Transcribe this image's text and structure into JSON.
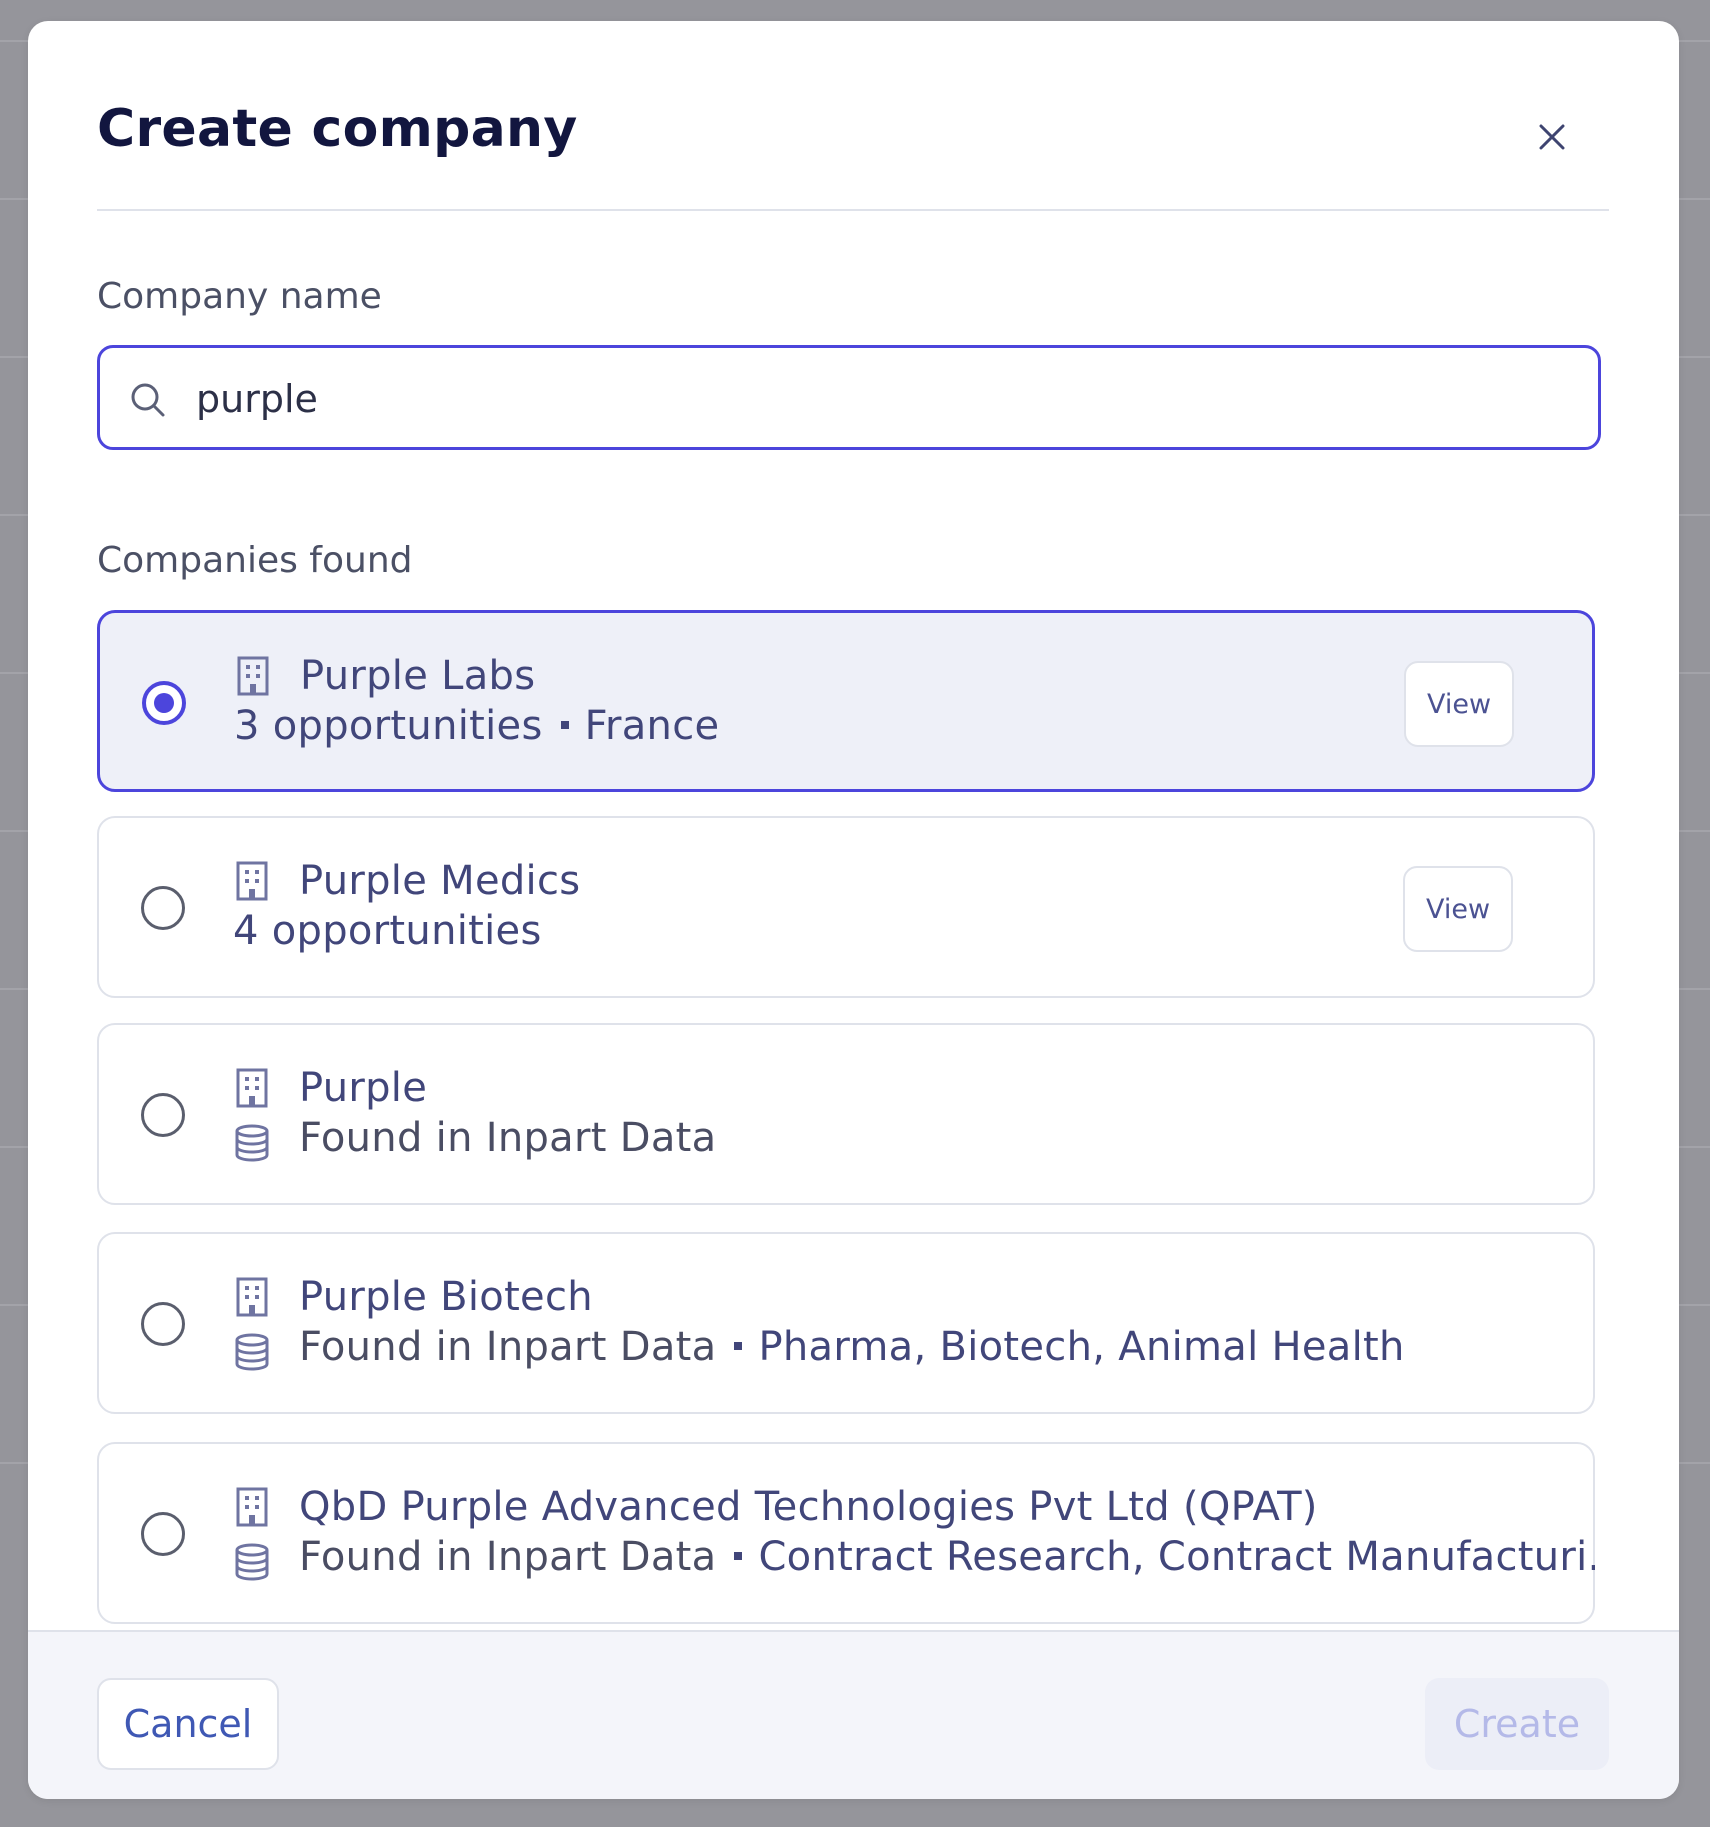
{
  "dialog": {
    "title": "Create company",
    "close_label": "×"
  },
  "form": {
    "company_name_label": "Company name",
    "search_value": "purple",
    "companies_found_label": "Companies found"
  },
  "companies": [
    {
      "name": "Purple Labs",
      "opportunities": "3 opportunities",
      "country": "France",
      "selected": true,
      "view_label": "View",
      "icons": [
        "building-icon"
      ]
    },
    {
      "name": "Purple Medics",
      "opportunities": "4 opportunities",
      "selected": false,
      "view_label": "View",
      "icons": [
        "building-icon"
      ]
    },
    {
      "name": "Purple",
      "source": "Found in Inpart Data",
      "selected": false,
      "icons": [
        "building-icon",
        "database-icon"
      ]
    },
    {
      "name": "Purple Biotech",
      "source": "Found in Inpart Data",
      "sectors": "Pharma, Biotech, Animal Health",
      "selected": false,
      "icons": [
        "building-icon",
        "database-icon"
      ]
    },
    {
      "name": "QbD Purple Advanced Technologies Pvt Ltd (QPAT)",
      "source": "Found in Inpart Data",
      "sectors": "Contract Research, Contract Manufacturi...",
      "selected": false,
      "icons": [
        "building-icon",
        "database-icon"
      ]
    }
  ],
  "footer": {
    "cancel_label": "Cancel",
    "create_label": "Create"
  },
  "colors": {
    "accent": "#4c45dc",
    "selected_bg": "#eef0f8",
    "title": "#12163f",
    "text": "#41467a",
    "overlay": "#95959b",
    "disabled_text": "#b4b9e8"
  }
}
